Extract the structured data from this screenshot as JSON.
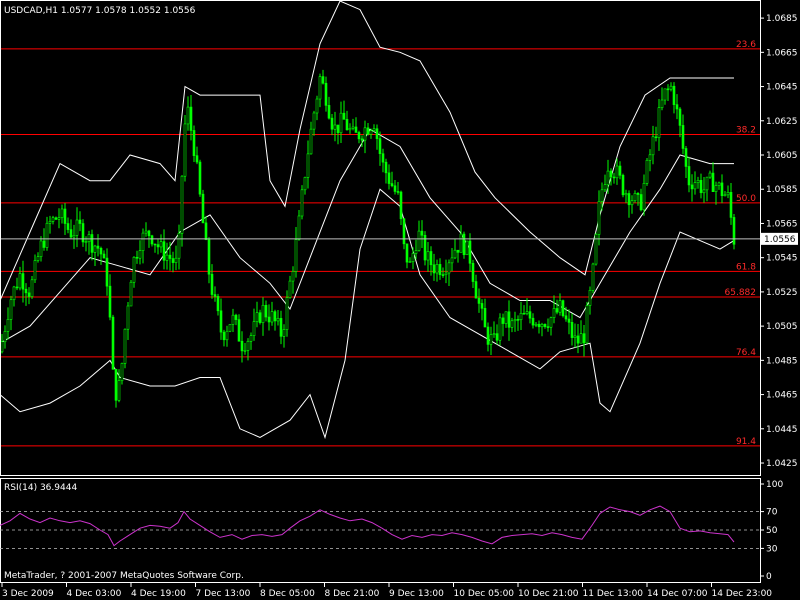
{
  "chart_data": [
    {
      "type": "candlestick",
      "header": "USDCAD,H1  1.0577 1.0578 1.0552 1.0556",
      "symbol": "USDCAD",
      "timeframe": "H1",
      "last_price": "1.0556",
      "ylim": [
        1.0418,
        1.0695
      ],
      "y_ticks": [
        "1.0685",
        "1.0665",
        "1.0645",
        "1.0625",
        "1.0605",
        "1.0585",
        "1.0565",
        "1.0545",
        "1.0525",
        "1.0505",
        "1.0485",
        "1.0465",
        "1.0445",
        "1.0425"
      ],
      "x_ticks": [
        "3 Dec 2009",
        "4 Dec 03:00",
        "4 Dec 19:00",
        "7 Dec 13:00",
        "8 Dec 05:00",
        "8 Dec 21:00",
        "9 Dec 13:00",
        "10 Dec 05:00",
        "10 Dec 21:00",
        "11 Dec 13:00",
        "14 Dec 07:00",
        "14 Dec 23:00"
      ],
      "fibonacci_levels": [
        {
          "label": "23.6",
          "price": 1.0667
        },
        {
          "label": "38.2",
          "price": 1.0617
        },
        {
          "label": "50.0",
          "price": 1.0577
        },
        {
          "label": "61.8",
          "price": 1.0537
        },
        {
          "label": "65.882",
          "price": 1.0522
        },
        {
          "label": "76.4",
          "price": 1.0487
        },
        {
          "label": "91.4",
          "price": 1.0435
        }
      ],
      "close_path": [
        [
          0,
          1.049
        ],
        [
          10,
          1.052
        ],
        [
          20,
          1.0535
        ],
        [
          30,
          1.0525
        ],
        [
          40,
          1.055
        ],
        [
          50,
          1.0565
        ],
        [
          60,
          1.057
        ],
        [
          70,
          1.056
        ],
        [
          80,
          1.0562
        ],
        [
          90,
          1.0555
        ],
        [
          100,
          1.055
        ],
        [
          108,
          1.053
        ],
        [
          114,
          1.0465
        ],
        [
          120,
          1.047
        ],
        [
          126,
          1.051
        ],
        [
          132,
          1.054
        ],
        [
          140,
          1.0555
        ],
        [
          150,
          1.056
        ],
        [
          160,
          1.055
        ],
        [
          170,
          1.0545
        ],
        [
          178,
          1.054
        ],
        [
          184,
          1.062
        ],
        [
          188,
          1.063
        ],
        [
          194,
          1.061
        ],
        [
          200,
          1.058
        ],
        [
          208,
          1.054
        ],
        [
          214,
          1.052
        ],
        [
          222,
          1.05
        ],
        [
          232,
          1.051
        ],
        [
          242,
          1.0495
        ],
        [
          252,
          1.05
        ],
        [
          262,
          1.0515
        ],
        [
          272,
          1.051
        ],
        [
          282,
          1.05
        ],
        [
          290,
          1.053
        ],
        [
          298,
          1.056
        ],
        [
          306,
          1.06
        ],
        [
          314,
          1.063
        ],
        [
          320,
          1.065
        ],
        [
          326,
          1.064
        ],
        [
          334,
          1.062
        ],
        [
          344,
          1.0625
        ],
        [
          354,
          1.0615
        ],
        [
          364,
          1.062
        ],
        [
          374,
          1.0625
        ],
        [
          382,
          1.06
        ],
        [
          390,
          1.059
        ],
        [
          398,
          1.058
        ],
        [
          404,
          1.055
        ],
        [
          410,
          1.054
        ],
        [
          418,
          1.056
        ],
        [
          426,
          1.0545
        ],
        [
          434,
          1.054
        ],
        [
          444,
          1.054
        ],
        [
          454,
          1.055
        ],
        [
          462,
          1.0555
        ],
        [
          470,
          1.0545
        ],
        [
          478,
          1.052
        ],
        [
          486,
          1.05
        ],
        [
          494,
          1.0495
        ],
        [
          502,
          1.051
        ],
        [
          512,
          1.0505
        ],
        [
          522,
          1.051
        ],
        [
          532,
          1.051
        ],
        [
          542,
          1.0508
        ],
        [
          552,
          1.051
        ],
        [
          560,
          1.0515
        ],
        [
          568,
          1.0505
        ],
        [
          576,
          1.0495
        ],
        [
          584,
          1.05
        ],
        [
          592,
          1.053
        ],
        [
          600,
          1.058
        ],
        [
          608,
          1.06
        ],
        [
          616,
          1.0595
        ],
        [
          624,
          1.0585
        ],
        [
          632,
          1.058
        ],
        [
          640,
          1.0575
        ],
        [
          648,
          1.06
        ],
        [
          656,
          1.062
        ],
        [
          664,
          1.064
        ],
        [
          672,
          1.0645
        ],
        [
          680,
          1.062
        ],
        [
          688,
          1.059
        ],
        [
          696,
          1.059
        ],
        [
          704,
          1.0585
        ],
        [
          712,
          1.059
        ],
        [
          720,
          1.0585
        ],
        [
          728,
          1.058
        ],
        [
          734,
          1.0556
        ]
      ],
      "bollinger_upper": [
        [
          0,
          1.052
        ],
        [
          30,
          1.056
        ],
        [
          60,
          1.06
        ],
        [
          90,
          1.059
        ],
        [
          110,
          1.059
        ],
        [
          130,
          1.0605
        ],
        [
          160,
          1.06
        ],
        [
          175,
          1.059
        ],
        [
          185,
          1.0645
        ],
        [
          200,
          1.064
        ],
        [
          230,
          1.064
        ],
        [
          260,
          1.064
        ],
        [
          270,
          1.059
        ],
        [
          285,
          1.0575
        ],
        [
          300,
          1.062
        ],
        [
          320,
          1.067
        ],
        [
          340,
          1.0695
        ],
        [
          360,
          1.069
        ],
        [
          380,
          1.0668
        ],
        [
          400,
          1.0665
        ],
        [
          420,
          1.066
        ],
        [
          450,
          1.063
        ],
        [
          475,
          1.0595
        ],
        [
          495,
          1.058
        ],
        [
          530,
          1.056
        ],
        [
          560,
          1.0545
        ],
        [
          585,
          1.0535
        ],
        [
          600,
          1.057
        ],
        [
          620,
          1.061
        ],
        [
          645,
          1.064
        ],
        [
          670,
          1.065
        ],
        [
          700,
          1.065
        ],
        [
          734,
          1.065
        ]
      ],
      "bollinger_middle": [
        [
          0,
          1.0495
        ],
        [
          30,
          1.0505
        ],
        [
          60,
          1.0525
        ],
        [
          90,
          1.0545
        ],
        [
          120,
          1.054
        ],
        [
          150,
          1.0535
        ],
        [
          180,
          1.056
        ],
        [
          210,
          1.057
        ],
        [
          240,
          1.0545
        ],
        [
          270,
          1.053
        ],
        [
          290,
          1.0515
        ],
        [
          310,
          1.0545
        ],
        [
          340,
          1.059
        ],
        [
          370,
          1.062
        ],
        [
          400,
          1.061
        ],
        [
          430,
          1.058
        ],
        [
          460,
          1.056
        ],
        [
          490,
          1.053
        ],
        [
          520,
          1.052
        ],
        [
          550,
          1.052
        ],
        [
          580,
          1.051
        ],
        [
          600,
          1.053
        ],
        [
          630,
          1.056
        ],
        [
          660,
          1.0585
        ],
        [
          680,
          1.0605
        ],
        [
          710,
          1.06
        ],
        [
          734,
          1.06
        ]
      ],
      "bollinger_lower": [
        [
          0,
          1.0465
        ],
        [
          20,
          1.0455
        ],
        [
          50,
          1.046
        ],
        [
          80,
          1.047
        ],
        [
          110,
          1.0485
        ],
        [
          120,
          1.0475
        ],
        [
          150,
          1.047
        ],
        [
          175,
          1.047
        ],
        [
          200,
          1.0475
        ],
        [
          220,
          1.0475
        ],
        [
          240,
          1.0445
        ],
        [
          260,
          1.044
        ],
        [
          290,
          1.045
        ],
        [
          310,
          1.0465
        ],
        [
          325,
          1.044
        ],
        [
          345,
          1.0485
        ],
        [
          360,
          1.055
        ],
        [
          380,
          1.0585
        ],
        [
          400,
          1.0575
        ],
        [
          420,
          1.0535
        ],
        [
          450,
          1.051
        ],
        [
          480,
          1.05
        ],
        [
          510,
          1.049
        ],
        [
          540,
          1.048
        ],
        [
          560,
          1.049
        ],
        [
          590,
          1.0495
        ],
        [
          600,
          1.046
        ],
        [
          610,
          1.0455
        ],
        [
          640,
          1.0495
        ],
        [
          660,
          1.053
        ],
        [
          680,
          1.056
        ],
        [
          700,
          1.0555
        ],
        [
          720,
          1.055
        ],
        [
          734,
          1.0555
        ]
      ]
    },
    {
      "type": "line",
      "label": "RSI(14) 36.9444",
      "ylim": [
        0,
        100
      ],
      "y_ticks": [
        "100",
        "70",
        "50",
        "30",
        "0"
      ],
      "levels": [
        70,
        50,
        30
      ],
      "series": [
        {
          "color": "#cc33cc",
          "points": [
            [
              0,
              55
            ],
            [
              10,
              60
            ],
            [
              20,
              68
            ],
            [
              30,
              62
            ],
            [
              40,
              58
            ],
            [
              50,
              63
            ],
            [
              60,
              60
            ],
            [
              70,
              58
            ],
            [
              80,
              60
            ],
            [
              90,
              57
            ],
            [
              100,
              50
            ],
            [
              108,
              45
            ],
            [
              114,
              33
            ],
            [
              120,
              38
            ],
            [
              130,
              45
            ],
            [
              140,
              52
            ],
            [
              150,
              55
            ],
            [
              160,
              54
            ],
            [
              170,
              52
            ],
            [
              178,
              58
            ],
            [
              184,
              70
            ],
            [
              190,
              62
            ],
            [
              200,
              55
            ],
            [
              210,
              48
            ],
            [
              220,
              42
            ],
            [
              232,
              45
            ],
            [
              242,
              40
            ],
            [
              252,
              44
            ],
            [
              262,
              45
            ],
            [
              272,
              43
            ],
            [
              282,
              45
            ],
            [
              290,
              52
            ],
            [
              300,
              60
            ],
            [
              310,
              65
            ],
            [
              320,
              72
            ],
            [
              330,
              67
            ],
            [
              340,
              63
            ],
            [
              350,
              60
            ],
            [
              362,
              62
            ],
            [
              372,
              58
            ],
            [
              382,
              52
            ],
            [
              392,
              45
            ],
            [
              402,
              40
            ],
            [
              412,
              44
            ],
            [
              422,
              42
            ],
            [
              432,
              45
            ],
            [
              442,
              44
            ],
            [
              452,
              47
            ],
            [
              462,
              45
            ],
            [
              472,
              42
            ],
            [
              482,
              38
            ],
            [
              492,
              35
            ],
            [
              502,
              42
            ],
            [
              512,
              44
            ],
            [
              522,
              45
            ],
            [
              532,
              46
            ],
            [
              542,
              44
            ],
            [
              552,
              47
            ],
            [
              562,
              45
            ],
            [
              572,
              42
            ],
            [
              582,
              40
            ],
            [
              592,
              55
            ],
            [
              600,
              68
            ],
            [
              610,
              75
            ],
            [
              620,
              72
            ],
            [
              630,
              70
            ],
            [
              640,
              66
            ],
            [
              650,
              72
            ],
            [
              660,
              76
            ],
            [
              670,
              70
            ],
            [
              680,
              52
            ],
            [
              690,
              48
            ],
            [
              700,
              49
            ],
            [
              710,
              47
            ],
            [
              720,
              46
            ],
            [
              728,
              45
            ],
            [
              734,
              37
            ]
          ]
        }
      ]
    }
  ],
  "footer": {
    "copyright": "MetaTrader, ? 2001-2007 MetaQuotes Software Corp."
  },
  "colors": {
    "background": "#000000",
    "bull": "#00ff00",
    "bear": "#00ff00",
    "bollinger": "#ffffff",
    "fibonacci": "#ff0000",
    "rsi": "#cc33cc"
  }
}
